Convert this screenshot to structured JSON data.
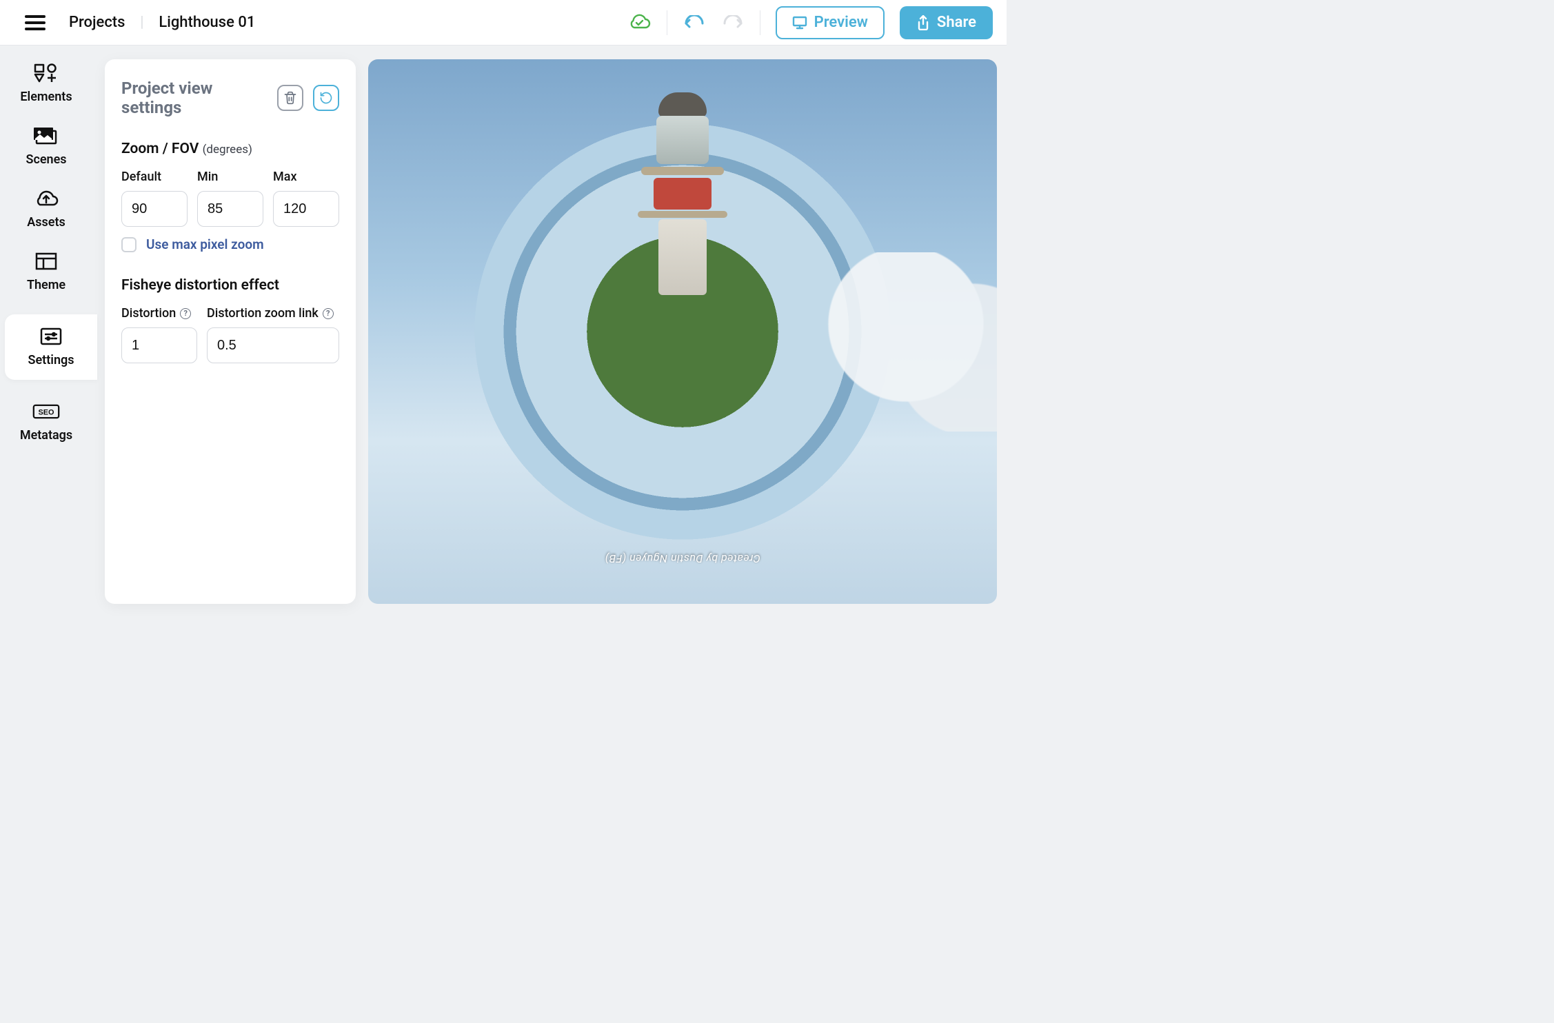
{
  "header": {
    "breadcrumb": [
      "Projects",
      "Lighthouse 01"
    ],
    "preview_label": "Preview",
    "share_label": "Share"
  },
  "sidebar": {
    "items": [
      {
        "label": "Elements"
      },
      {
        "label": "Scenes"
      },
      {
        "label": "Assets"
      },
      {
        "label": "Theme"
      },
      {
        "label": "Settings"
      },
      {
        "label": "Metatags"
      }
    ],
    "active_index": 4
  },
  "panel": {
    "title": "Project view settings",
    "zoom": {
      "section_label": "Zoom / FOV",
      "unit_label": "(degrees)",
      "default_label": "Default",
      "min_label": "Min",
      "max_label": "Max",
      "default_value": "90",
      "min_value": "85",
      "max_value": "120",
      "max_pixel_zoom_label": "Use max pixel zoom",
      "max_pixel_zoom_checked": false
    },
    "fisheye": {
      "section_label": "Fisheye distortion effect",
      "distortion_label": "Distortion",
      "zoomlink_label": "Distortion zoom link",
      "distortion_value": "1",
      "zoomlink_value": "0.5"
    }
  },
  "preview": {
    "credit": "Created by Dustin Nguyen (FB)"
  },
  "colors": {
    "accent": "#4cb1d9",
    "cloud_ok": "#4bb34b"
  }
}
